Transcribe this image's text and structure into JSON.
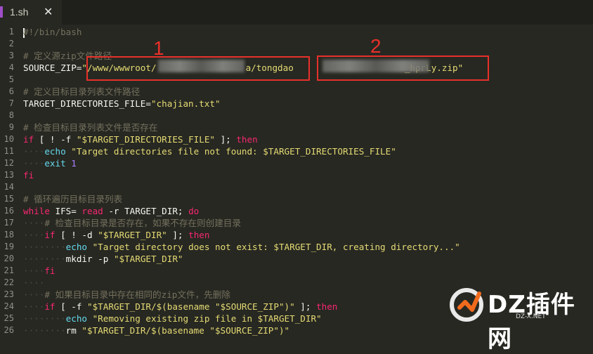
{
  "tab": {
    "label": "1.sh",
    "close": "✕"
  },
  "line_numbers": [
    "1",
    "2",
    "3",
    "4",
    "5",
    "6",
    "7",
    "8",
    "9",
    "10",
    "11",
    "12",
    "13",
    "14",
    "15",
    "16",
    "17",
    "18",
    "19",
    "20",
    "21",
    "22",
    "23",
    "24",
    "25",
    "26"
  ],
  "code": {
    "l1": "#!/bin/bash",
    "l3": "# 定义源zip文件路径",
    "l4_var": "SOURCE_ZIP=",
    "l4_path_a": "\"/www/wwwroot/",
    "l4_path_b": "a/tongdao",
    "l4_path_c": "_hprLy.zip\"",
    "l6": "# 定义目标目录列表文件路径",
    "l7_var": "TARGET_DIRECTORIES_FILE=",
    "l7_val": "\"chajian.txt\"",
    "l9": "# 检查目标目录列表文件是否存在",
    "l10_if": "if",
    "l10_a": " [ ! -f ",
    "l10_str": "\"$TARGET_DIRECTORIES_FILE\"",
    "l10_b": " ]; ",
    "l10_then": "then",
    "l11_cmd": "echo",
    "l11_str": " \"Target directories file not found: $TARGET_DIRECTORIES_FILE\"",
    "l12_cmd": "exit",
    "l12_num": " 1",
    "l13": "fi",
    "l15": "# 循环遍历目标目录列表",
    "l16_while": "while",
    "l16_a": " IFS= ",
    "l16_read": "read",
    "l16_b": " -r TARGET_DIR; ",
    "l16_do": "do",
    "l17": "# 检查目标目录是否存在，如果不存在则创建目录",
    "l18_if": "if",
    "l18_a": " [ ! -d ",
    "l18_str": "\"$TARGET_DIR\"",
    "l18_b": " ]; ",
    "l18_then": "then",
    "l19_cmd": "echo",
    "l19_str": " \"Target directory does not exist: $TARGET_DIR, creating directory...\"",
    "l20_cmd": "mkdir",
    "l20_a": " -p ",
    "l20_str": "\"$TARGET_DIR\"",
    "l21": "fi",
    "l23": "# 如果目标目录中存在相同的zip文件，先删除",
    "l24_if": "if",
    "l24_a": " [ -f ",
    "l24_str": "\"$TARGET_DIR/$(basename \"$SOURCE_ZIP\")\"",
    "l24_b": " ]; ",
    "l24_then": "then",
    "l25_cmd": "echo",
    "l25_str": " \"Removing existing zip file in $TARGET_DIR\"",
    "l26_cmd": "rm",
    "l26_str": " \"$TARGET_DIR/$(basename \"$SOURCE_ZIP\")\""
  },
  "annotations": {
    "box1": "1",
    "box2": "2"
  },
  "watermark": {
    "brand": "DZ插件网",
    "url": "DZ-X.NET"
  },
  "colors": {
    "background": "#272822",
    "comment": "#75715e",
    "keyword": "#f92672",
    "string": "#e6db74",
    "number": "#ae81ff",
    "builtin": "#66d9ef",
    "annotation": "#e8302a"
  }
}
